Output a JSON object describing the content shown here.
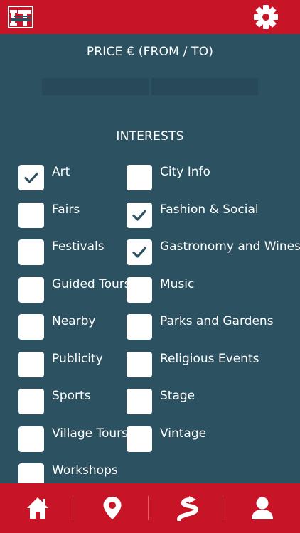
{
  "header": {
    "logo_icon": "it-logo",
    "settings_icon": "gear-icon"
  },
  "price": {
    "title": "PRICE € (FROM / TO)",
    "from_value": "",
    "to_value": ""
  },
  "interests": {
    "title": "INTERESTS",
    "items": [
      {
        "label": "Art",
        "checked": true
      },
      {
        "label": "City Info",
        "checked": false
      },
      {
        "label": "Fairs",
        "checked": false
      },
      {
        "label": "Fashion & Social",
        "checked": true
      },
      {
        "label": "Festivals",
        "checked": false
      },
      {
        "label": "Gastronomy and Wines",
        "checked": true
      },
      {
        "label": "Guided Tours",
        "checked": false
      },
      {
        "label": "Music",
        "checked": false
      },
      {
        "label": "Nearby",
        "checked": false
      },
      {
        "label": "Parks and Gardens",
        "checked": false
      },
      {
        "label": "Publicity",
        "checked": false
      },
      {
        "label": "Religious Events",
        "checked": false
      },
      {
        "label": "Sports",
        "checked": false
      },
      {
        "label": "Stage",
        "checked": false
      },
      {
        "label": "Village Tours",
        "checked": false
      },
      {
        "label": "Vintage",
        "checked": false
      },
      {
        "label": "Workshops",
        "checked": false
      }
    ]
  },
  "navbar": {
    "items": [
      {
        "icon": "home-icon"
      },
      {
        "icon": "location-pin-icon"
      },
      {
        "icon": "route-icon"
      },
      {
        "icon": "user-icon"
      }
    ]
  },
  "colors": {
    "brand_red": "#c81427",
    "background": "#2c5262",
    "input_bg": "#28495a",
    "check": "#2c5262"
  }
}
